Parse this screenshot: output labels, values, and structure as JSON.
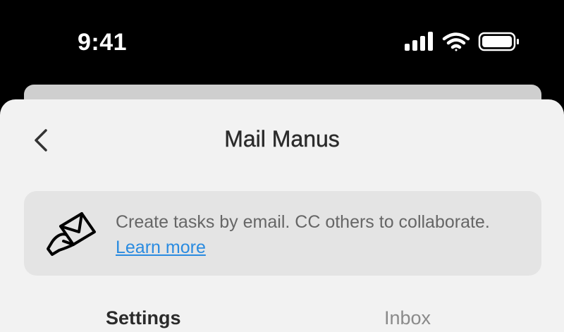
{
  "status_bar": {
    "time": "9:41",
    "icons": [
      "cellular-signal-icon",
      "wifi-icon",
      "battery-icon"
    ]
  },
  "header": {
    "back_icon": "chevron-left-icon",
    "title": "Mail Manus"
  },
  "info_card": {
    "icon": "hand-envelope-icon",
    "text": "Create tasks by email. CC others to collaborate.",
    "link_label": "Learn more",
    "link_color": "#2a8be0"
  },
  "tabs": [
    {
      "label": "Settings",
      "active": true
    },
    {
      "label": "Inbox",
      "active": false
    }
  ],
  "colors": {
    "background": "#000000",
    "sheet": "#f2f2f2",
    "card": "#e4e4e4",
    "title_text": "#2b2b2b",
    "body_text": "#666666"
  }
}
